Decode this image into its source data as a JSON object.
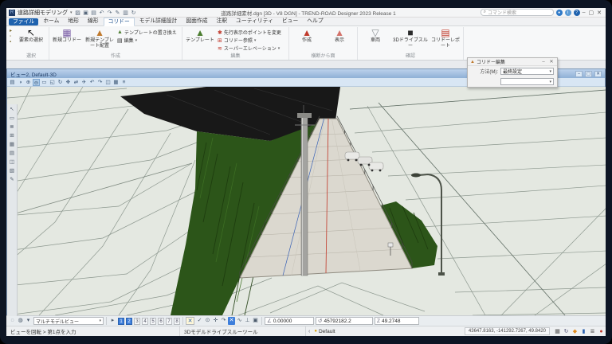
{
  "window": {
    "app_glyph": "R",
    "workflow": "道路詳細モデリング",
    "title": "道路詳細素材.dgn [3D - V8 DGN] - TREND-ROAD Designer 2023 Release 1",
    "search_placeholder": "コマンド検索",
    "quick_access_icons": [
      {
        "name": "open-file-icon",
        "glyph": "▨"
      },
      {
        "name": "save-icon",
        "glyph": "▣"
      },
      {
        "name": "save-settings-icon",
        "glyph": "▤"
      },
      {
        "name": "undo-icon",
        "glyph": "↶"
      },
      {
        "name": "redo-icon",
        "glyph": "↷"
      },
      {
        "name": "annotate-icon",
        "glyph": "✎"
      },
      {
        "name": "print-icon",
        "glyph": "▥"
      },
      {
        "name": "reload-icon",
        "glyph": "↻"
      }
    ],
    "help_icons": [
      {
        "name": "account-icon",
        "glyph": "●"
      },
      {
        "name": "info-icon",
        "glyph": "i"
      },
      {
        "name": "help-icon",
        "glyph": "?"
      }
    ],
    "minimize_glyph": "–",
    "maximize_glyph": "▢",
    "close_glyph": "✕"
  },
  "ribbon": {
    "caret_glyph": "▾",
    "tabs": [
      {
        "label": "ファイル"
      },
      {
        "label": "ホーム"
      },
      {
        "label": "地形"
      },
      {
        "label": "線形"
      },
      {
        "label": "コリドー"
      },
      {
        "label": "モデル詳細設計"
      },
      {
        "label": "図面作成"
      },
      {
        "label": "注釈"
      },
      {
        "label": "ユーティリティ"
      },
      {
        "label": "ビュー"
      },
      {
        "label": "ヘルプ"
      }
    ],
    "mode_icons": [
      {
        "name": "pointer-mini-icon",
        "glyph": "▸"
      },
      {
        "name": "fence-mini-icon",
        "glyph": "▫"
      },
      {
        "name": "style-mini-icon",
        "glyph": "▪"
      }
    ],
    "groups": [
      {
        "label": "選択",
        "items": [
          {
            "label": "要素の選択",
            "glyph": "↖"
          }
        ]
      },
      {
        "label": "作成",
        "items": [
          {
            "label": "新規コリドー",
            "glyph": "▦"
          },
          {
            "label": "新規テンプレート配置",
            "glyph": "▲"
          },
          {
            "label": "テンプレートの置き換え",
            "glyph": "▲"
          },
          {
            "label": "編集",
            "glyph": "▤"
          }
        ]
      },
      {
        "label": "編集",
        "items": [
          {
            "label": "テンプレート",
            "glyph": "▲"
          },
          {
            "label": "先行表示のポイントを変更",
            "glyph": "✱"
          },
          {
            "label": "コリドー参照",
            "glyph": "⊞"
          },
          {
            "label": "スーパーエレベーション",
            "glyph": "≋"
          }
        ]
      },
      {
        "label": "横断から面",
        "items": [
          {
            "label": "作成",
            "glyph": "▲"
          },
          {
            "label": "表示",
            "glyph": "▲"
          }
        ]
      },
      {
        "label": "確認",
        "items": [
          {
            "label": "車両",
            "glyph": "▽"
          },
          {
            "label": "3Dドライブスルー",
            "glyph": "■"
          },
          {
            "label": "コリドーレポート",
            "glyph": "▤"
          }
        ]
      }
    ]
  },
  "tool_dialog": {
    "icon_glyph": "▲",
    "title": "コリドー編集",
    "row_label": "方法(M):",
    "row_value": "最終設定",
    "row2_value": "",
    "minimize_glyph": "–",
    "close_glyph": "✕"
  },
  "view": {
    "title": "ビュー2, Default-3D",
    "toolbar_icons": [
      {
        "name": "view-attributes-icon",
        "glyph": "▤"
      },
      {
        "name": "display-style-icon",
        "glyph": "◑"
      },
      {
        "name": "zoom-in-icon",
        "glyph": "⊕"
      },
      {
        "name": "zoom-out-icon",
        "glyph": "⊖",
        "active": true
      },
      {
        "name": "window-area-icon",
        "glyph": "▭"
      },
      {
        "name": "fit-view-icon",
        "glyph": "◱"
      },
      {
        "name": "rotate-view-icon",
        "glyph": "↻"
      },
      {
        "name": "pan-view-icon",
        "glyph": "✥"
      },
      {
        "name": "walk-icon",
        "glyph": "⇄"
      },
      {
        "name": "fly-icon",
        "glyph": "✈"
      },
      {
        "name": "previous-view-icon",
        "glyph": "↶"
      },
      {
        "name": "next-view-icon",
        "glyph": "↷"
      },
      {
        "name": "copy-view-icon",
        "glyph": "◫"
      },
      {
        "name": "clip-volume-icon",
        "glyph": "▦"
      },
      {
        "name": "clip-mask-icon",
        "glyph": "≡"
      }
    ],
    "minimize_glyph": "–",
    "restore_glyph": "▢",
    "close_glyph": "✕"
  },
  "left_toolbar_icons": [
    {
      "name": "select-tool-icon",
      "glyph": "↖"
    },
    {
      "name": "fence-tool-icon",
      "glyph": "▭"
    },
    {
      "name": "explorer-icon",
      "glyph": "≣"
    },
    {
      "name": "attach-tools-icon",
      "glyph": "⊞"
    },
    {
      "name": "models-icon",
      "glyph": "▦"
    },
    {
      "name": "level-display-icon",
      "glyph": "▤"
    },
    {
      "name": "references-icon",
      "glyph": "◫"
    },
    {
      "name": "raster-manager-icon",
      "glyph": "▧"
    },
    {
      "name": "markup-icon",
      "glyph": "✎"
    }
  ],
  "bottom": {
    "aids_icons": [
      {
        "name": "snaps-menu-button",
        "glyph": "◌"
      },
      {
        "name": "locks-menu-button",
        "glyph": "◍"
      },
      {
        "name": "display-rules-button",
        "glyph": "▾"
      }
    ],
    "multimodel_label": "マルチモデルビュー",
    "view_group_glyph": "▸",
    "view_numbers": [
      "1",
      "2",
      "3",
      "4",
      "5",
      "6",
      "7",
      "8"
    ],
    "compass_glyph": "✕",
    "snap_icons": [
      {
        "name": "snap-origin-icon",
        "glyph": "✓"
      },
      {
        "name": "snap-center-icon",
        "glyph": "⊙"
      },
      {
        "name": "snap-midpoint-icon",
        "glyph": "✛"
      },
      {
        "name": "snap-rotate-icon",
        "glyph": "↷"
      },
      {
        "name": "snap-intersection-icon",
        "glyph": "✕",
        "active": true
      },
      {
        "name": "snap-tangent-icon",
        "glyph": "∿"
      },
      {
        "name": "snap-perpendicular-icon",
        "glyph": "⊥"
      },
      {
        "name": "snap-settings-icon",
        "glyph": "▣"
      }
    ],
    "accudraw": {
      "f1_label": "∠",
      "f1_value": "0.00000",
      "f2_label": "↺",
      "f2_value": "45792182.2",
      "f3_label": "Z",
      "f3_value": "49.2748"
    }
  },
  "status": {
    "prompt": "ビューを回転 > 第1点を入力",
    "tool": "3Dモデルドライブスルーツール",
    "chevron": "‹",
    "lock_glyph": "●",
    "mode": "Default",
    "coords": "43647.8163, -141292.7267, 49.8420",
    "icons": [
      {
        "name": "save-status-icon",
        "glyph": "▦",
        "cls": "save"
      },
      {
        "name": "refresh-icon",
        "glyph": "↻",
        "cls": "refresh"
      },
      {
        "name": "alert-icon",
        "glyph": "◆",
        "cls": "alert"
      },
      {
        "name": "model-indicator-icon",
        "glyph": "▮",
        "cls": "model"
      },
      {
        "name": "list-icon",
        "glyph": "≣",
        "cls": "list"
      },
      {
        "name": "record-icon",
        "glyph": "●",
        "cls": "rec"
      }
    ]
  },
  "colors": {
    "accent": "#1e62ae",
    "viewport_bg": "#e4e8e1",
    "slope_green": "#2c5519",
    "road": "#dbd8cf",
    "tunnel": "#181818",
    "centerline": "#c4483a",
    "alignment_blue": "#3a62b5"
  }
}
